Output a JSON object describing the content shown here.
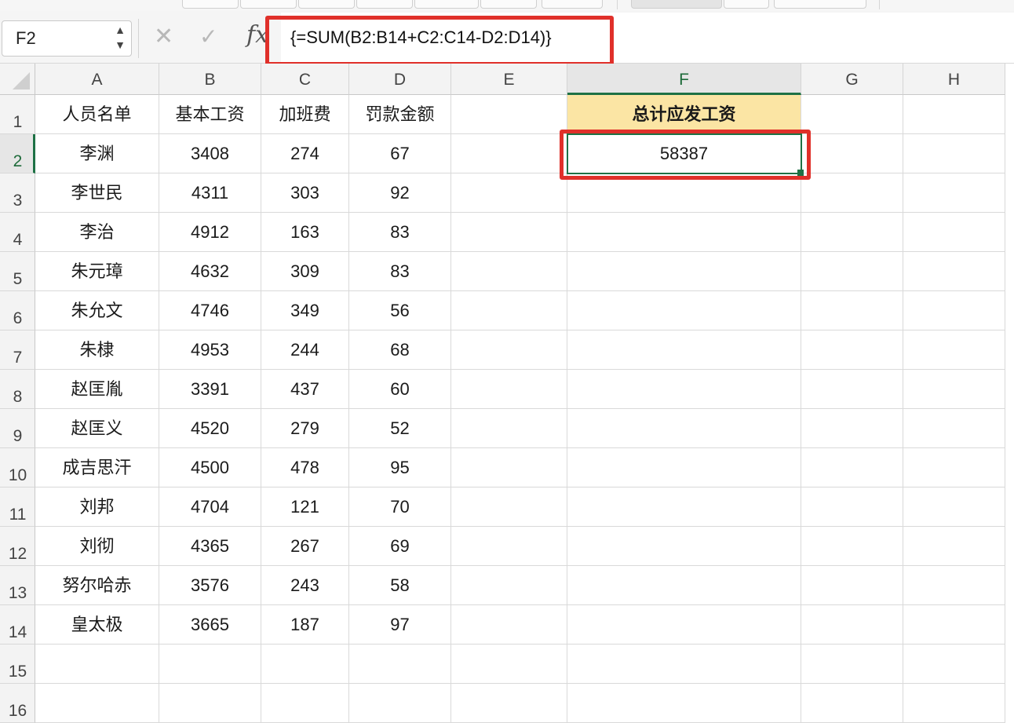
{
  "formula_bar": {
    "name_box": "F2",
    "name_box_arrows": "▲▼",
    "cancel_glyph": "✕",
    "enter_glyph": "✓",
    "fx_label": "fx",
    "formula": "{=SUM(B2:B14+C2:C14-D2:D14)}"
  },
  "columns": [
    "A",
    "B",
    "C",
    "D",
    "E",
    "F",
    "G",
    "H"
  ],
  "active_column": "F",
  "active_row": 2,
  "row_numbers": [
    "1",
    "2",
    "3",
    "4",
    "5",
    "6",
    "7",
    "8",
    "9",
    "10",
    "11",
    "12",
    "13",
    "14",
    "15",
    "16"
  ],
  "table": {
    "headers": [
      "人员名单",
      "基本工资",
      "加班费",
      "罚款金额"
    ],
    "rows": [
      [
        "李渊",
        "3408",
        "274",
        "67"
      ],
      [
        "李世民",
        "4311",
        "303",
        "92"
      ],
      [
        "李治",
        "4912",
        "163",
        "83"
      ],
      [
        "朱元璋",
        "4632",
        "309",
        "83"
      ],
      [
        "朱允文",
        "4746",
        "349",
        "56"
      ],
      [
        "朱棣",
        "4953",
        "244",
        "68"
      ],
      [
        "赵匡胤",
        "3391",
        "437",
        "60"
      ],
      [
        "赵匡义",
        "4520",
        "279",
        "52"
      ],
      [
        "成吉思汗",
        "4500",
        "478",
        "95"
      ],
      [
        "刘邦",
        "4704",
        "121",
        "70"
      ],
      [
        "刘彻",
        "4365",
        "267",
        "69"
      ],
      [
        "努尔哈赤",
        "3576",
        "243",
        "58"
      ],
      [
        "皇太极",
        "3665",
        "187",
        "97"
      ]
    ]
  },
  "summary": {
    "header": "总计应发工资",
    "value": "58387"
  },
  "colors": {
    "highlight_red": "#e0302a",
    "header_yellow": "#fbe5a4",
    "selection_green": "#1e7145"
  }
}
